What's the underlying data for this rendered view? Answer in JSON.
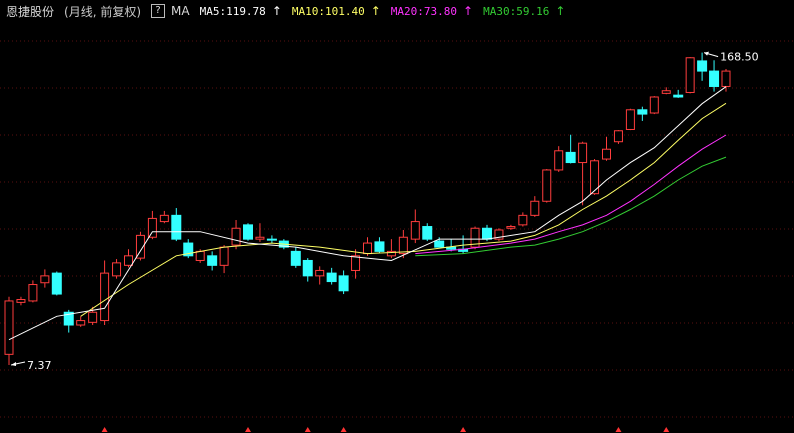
{
  "header": {
    "stock_name": "恩捷股份",
    "period": "(月线, 前复权)",
    "help_label": "?",
    "ma_label": "MA",
    "ma": [
      {
        "name": "MA5",
        "text": "MA5:119.78",
        "color": "#ffffff",
        "arrow": "↑",
        "arrow_icon": "up-arrow-icon"
      },
      {
        "name": "MA10",
        "text": "MA10:101.40",
        "color": "#ffff66",
        "arrow": "↑",
        "arrow_icon": "up-arrow-icon"
      },
      {
        "name": "MA20",
        "text": "MA20:73.80",
        "color": "#ff33ff",
        "arrow": "↑",
        "arrow_icon": "up-arrow-icon"
      },
      {
        "name": "MA30",
        "text": "MA30:59.16",
        "color": "#33cc33",
        "arrow": "↑",
        "arrow_icon": "up-arrow-icon"
      }
    ]
  },
  "chart_data": {
    "type": "candlestick",
    "max_label": "168.50",
    "min_label": "7.37",
    "ylim": [
      4,
      180
    ],
    "grid": true,
    "colors": {
      "up": "#ff3d3d",
      "down": "#33ffff",
      "ma5": "#ffffff",
      "ma10": "#ffff66",
      "ma20": "#ff33ff",
      "ma30": "#33cc33",
      "grid": "#5a1010",
      "marker": "#ff3333"
    },
    "candles": [
      [
        8.2,
        14,
        7.37,
        14.6
      ],
      [
        13.8,
        14.2,
        13.4,
        14.6
      ],
      [
        14,
        16.5,
        13.8,
        17.2
      ],
      [
        16.8,
        18,
        16,
        19.2
      ],
      [
        18.5,
        15,
        14.8,
        18.8
      ],
      [
        12.5,
        11,
        10.2,
        12.8
      ],
      [
        11,
        11.5,
        10.8,
        12
      ],
      [
        11.3,
        12.5,
        11,
        13.2
      ],
      [
        11.5,
        18.5,
        11,
        21
      ],
      [
        18,
        20.5,
        17.5,
        21.3
      ],
      [
        20,
        22,
        19.6,
        23.5
      ],
      [
        21.5,
        27,
        21,
        28
      ],
      [
        26.5,
        32,
        26,
        34.5
      ],
      [
        31,
        33,
        30.5,
        34.5
      ],
      [
        33,
        26,
        25.5,
        35.5
      ],
      [
        25,
        22,
        21.5,
        26
      ],
      [
        21,
        23,
        20.5,
        23.5
      ],
      [
        22,
        20,
        19,
        23
      ],
      [
        20,
        24,
        18.5,
        24.5
      ],
      [
        24.5,
        29,
        23.5,
        31.5
      ],
      [
        30,
        26,
        25.6,
        30.5
      ],
      [
        26,
        26.5,
        25.3,
        30.5
      ],
      [
        26,
        25.8,
        25,
        27
      ],
      [
        25.5,
        24,
        23.5,
        26
      ],
      [
        23,
        20,
        19.5,
        24
      ],
      [
        21,
        18,
        17,
        21.5
      ],
      [
        18,
        19,
        16.5,
        19.8
      ],
      [
        18.5,
        17,
        16.5,
        19.5
      ],
      [
        18,
        15.5,
        15,
        19
      ],
      [
        19,
        22,
        17.5,
        23.5
      ],
      [
        22.5,
        25,
        22,
        26.5
      ],
      [
        25.3,
        23,
        22.6,
        26.5
      ],
      [
        22,
        23,
        21.5,
        26
      ],
      [
        22.5,
        26.5,
        21.5,
        28.5
      ],
      [
        26,
        31,
        25,
        35
      ],
      [
        29.5,
        26,
        25.5,
        30.5
      ],
      [
        25.5,
        24,
        24,
        26.5
      ],
      [
        24,
        23.5,
        23,
        26
      ],
      [
        23.5,
        23,
        22.5,
        27
      ],
      [
        24,
        29,
        23.5,
        29.5
      ],
      [
        29,
        26,
        25.5,
        30
      ],
      [
        26,
        28.5,
        25.5,
        29
      ],
      [
        29,
        29.5,
        28.5,
        30
      ],
      [
        30,
        33,
        29.5,
        34
      ],
      [
        33,
        38,
        32.5,
        40
      ],
      [
        38,
        52,
        37.5,
        52.5
      ],
      [
        52,
        63,
        51,
        66
      ],
      [
        62,
        56,
        55.5,
        74
      ],
      [
        56,
        68,
        36.5,
        69
      ],
      [
        41,
        57,
        40.5,
        58
      ],
      [
        58,
        64,
        57,
        72.5
      ],
      [
        69,
        77,
        67.5,
        77.5
      ],
      [
        78,
        95,
        77.5,
        96
      ],
      [
        95,
        91,
        85,
        98
      ],
      [
        92,
        108,
        91,
        109
      ],
      [
        112,
        115,
        111,
        119
      ],
      [
        110,
        108,
        107,
        116
      ],
      [
        113,
        160,
        112,
        161
      ],
      [
        155,
        140,
        127,
        168.5
      ],
      [
        140,
        120,
        114,
        156
      ],
      [
        120,
        140,
        114,
        143
      ]
    ],
    "ma5": [
      [
        0,
        9.5
      ],
      [
        4,
        12
      ],
      [
        8,
        13
      ],
      [
        12,
        28
      ],
      [
        16,
        28
      ],
      [
        20,
        25
      ],
      [
        24,
        24
      ],
      [
        28,
        22
      ],
      [
        32,
        21
      ],
      [
        36,
        26
      ],
      [
        40,
        26
      ],
      [
        44,
        28
      ],
      [
        46,
        33
      ],
      [
        48,
        38
      ],
      [
        50,
        47
      ],
      [
        52,
        56
      ],
      [
        54,
        65
      ],
      [
        56,
        81
      ],
      [
        58,
        101
      ],
      [
        60,
        119.78
      ]
    ],
    "ma10": [
      [
        6,
        12
      ],
      [
        10,
        16.5
      ],
      [
        14,
        22
      ],
      [
        18,
        24
      ],
      [
        22,
        25
      ],
      [
        26,
        24
      ],
      [
        30,
        22.5
      ],
      [
        34,
        23
      ],
      [
        38,
        24.5
      ],
      [
        42,
        25.5
      ],
      [
        44,
        27
      ],
      [
        46,
        30
      ],
      [
        48,
        35
      ],
      [
        50,
        40
      ],
      [
        52,
        47
      ],
      [
        54,
        56
      ],
      [
        56,
        70
      ],
      [
        58,
        87
      ],
      [
        60,
        101.4
      ]
    ],
    "ma20": [
      [
        34,
        22.5
      ],
      [
        38,
        23.5
      ],
      [
        42,
        25
      ],
      [
        44,
        26
      ],
      [
        46,
        28
      ],
      [
        48,
        30
      ],
      [
        50,
        33
      ],
      [
        52,
        38
      ],
      [
        54,
        45
      ],
      [
        56,
        54
      ],
      [
        58,
        64
      ],
      [
        60,
        73.8
      ]
    ],
    "ma30": [
      [
        34,
        22
      ],
      [
        38,
        22.5
      ],
      [
        42,
        24
      ],
      [
        44,
        24.5
      ],
      [
        46,
        26
      ],
      [
        48,
        28
      ],
      [
        50,
        31
      ],
      [
        52,
        35
      ],
      [
        54,
        40
      ],
      [
        56,
        47
      ],
      [
        58,
        54
      ],
      [
        60,
        59.16
      ]
    ],
    "marker_indices": [
      8,
      20,
      25,
      28,
      38,
      51,
      55
    ]
  }
}
